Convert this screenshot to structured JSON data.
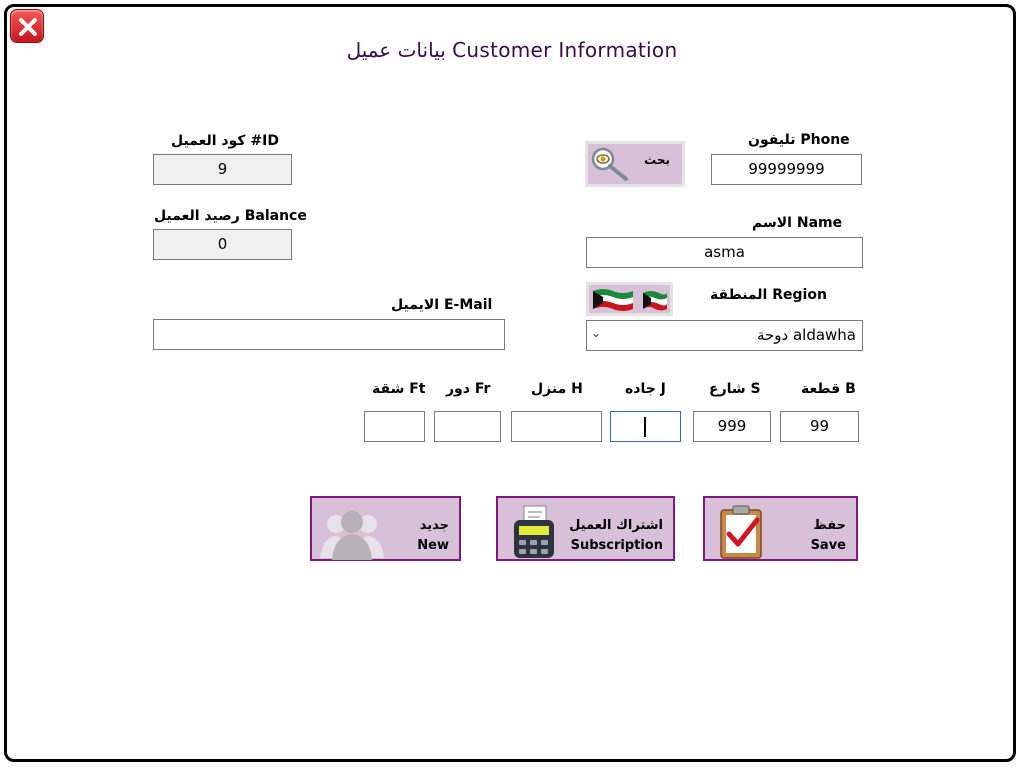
{
  "window": {
    "title": "بيانات عميل Customer Information"
  },
  "fields": {
    "customer_id": {
      "label": "كود العميل #ID",
      "value": "9"
    },
    "balance": {
      "label": "رصيد العميل Balance",
      "value": "0"
    },
    "email": {
      "label": "الايميل E-Mail",
      "value": ""
    },
    "phone": {
      "label": "تليفون Phone",
      "value": "99999999"
    },
    "name": {
      "label": "الاسم  Name",
      "value": "asma"
    },
    "region": {
      "label": "المنطقة Region",
      "value": "دوحة aldawha"
    }
  },
  "search_button": {
    "label": "بحث"
  },
  "address": {
    "block": {
      "label": "قطعة B",
      "value": "99"
    },
    "street": {
      "label": "شارع S",
      "value": "999"
    },
    "avenue": {
      "label": "جاده J",
      "value": ""
    },
    "house": {
      "label": "منزل H",
      "value": ""
    },
    "floor": {
      "label": "دور Fr",
      "value": ""
    },
    "flat": {
      "label": "شقة Ft",
      "value": ""
    }
  },
  "actions": {
    "save": {
      "arabic": "حفظ",
      "english": "Save"
    },
    "subscription": {
      "arabic": "اشتراك العميل",
      "english": "Subscription"
    },
    "new": {
      "arabic": "جديد",
      "english": "New"
    }
  },
  "colors": {
    "accent": "#d9c0d9",
    "border_accent": "#7d1a7d",
    "title": "#3a0a4a"
  }
}
